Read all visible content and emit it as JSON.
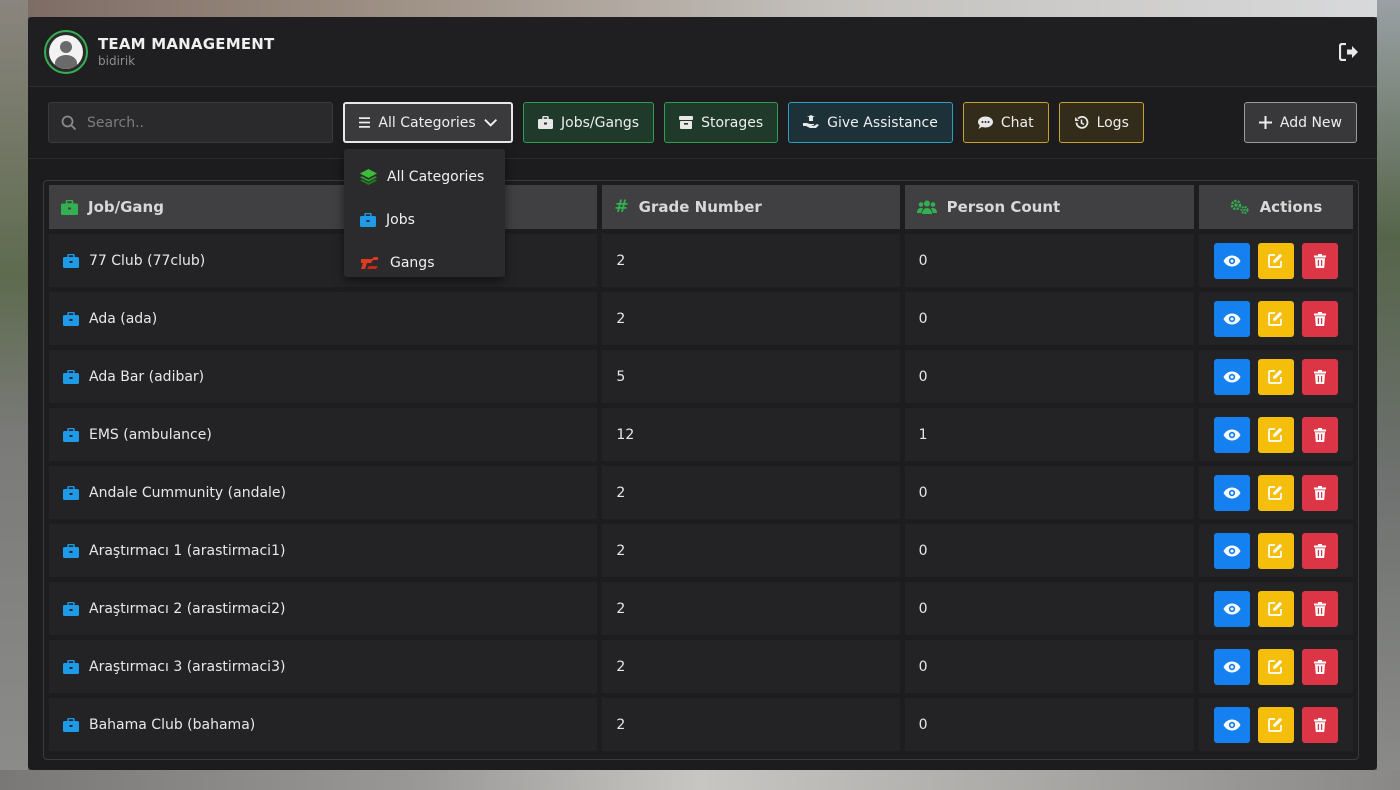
{
  "header": {
    "title": "TEAM MANAGEMENT",
    "user": "bidirik",
    "logout_icon": "sign-out-icon"
  },
  "toolbar": {
    "search_placeholder": "Search..",
    "category_label": "All Categories",
    "jobs_gangs_label": "Jobs/Gangs",
    "storages_label": "Storages",
    "give_assistance_label": "Give Assistance",
    "chat_label": "Chat",
    "logs_label": "Logs",
    "add_new_label": "Add New"
  },
  "dropdown": {
    "items": [
      {
        "label": "All Categories",
        "icon": "layers-icon"
      },
      {
        "label": "Jobs",
        "icon": "briefcase-icon"
      },
      {
        "label": "Gangs",
        "icon": "gang-icon"
      }
    ]
  },
  "table": {
    "headers": {
      "job_gang": "Job/Gang",
      "grade_number": "Grade Number",
      "person_count": "Person Count",
      "actions": "Actions"
    },
    "rows": [
      {
        "name": "77 Club (77club)",
        "grade": "2",
        "count": "0"
      },
      {
        "name": "Ada (ada)",
        "grade": "2",
        "count": "0"
      },
      {
        "name": "Ada Bar (adibar)",
        "grade": "5",
        "count": "0"
      },
      {
        "name": "EMS (ambulance)",
        "grade": "12",
        "count": "1"
      },
      {
        "name": "Andale Cummunity (andale)",
        "grade": "2",
        "count": "0"
      },
      {
        "name": "Araştırmacı 1 (arastirmaci1)",
        "grade": "2",
        "count": "0"
      },
      {
        "name": "Araştırmacı 2 (arastirmaci2)",
        "grade": "2",
        "count": "0"
      },
      {
        "name": "Araştırmacı 3 (arastirmaci3)",
        "grade": "2",
        "count": "0"
      },
      {
        "name": "Bahama Club (bahama)",
        "grade": "2",
        "count": "0"
      }
    ]
  },
  "colors": {
    "accent_green": "#33b050",
    "job_blue": "#1e9be8",
    "view_blue": "#1580f0",
    "edit_yellow": "#f5be0a",
    "delete_red": "#dc3545"
  }
}
